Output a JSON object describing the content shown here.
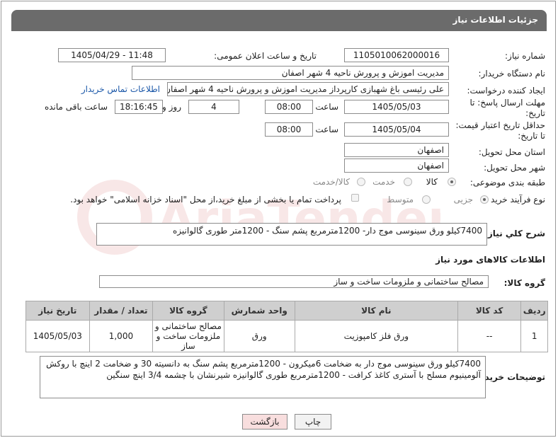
{
  "title": "جزئیات اطلاعات نیاز",
  "fields": {
    "need_number_label": "شماره نیاز:",
    "need_number": "1105010062000016",
    "announce_label": "تاریخ و ساعت اعلان عمومی:",
    "announce_value": "1405/04/29 - 11:48",
    "buyer_org_label": "نام دستگاه خریدار:",
    "buyer_org": "مدیریت اموزش و پرورش ناحیه 4 شهر اصفان",
    "creator_label": "ایجاد کننده درخواست:",
    "creator": "علی رئیسی باغ شهبازی کارپرداز مدیریت اموزش و پرورش ناحیه 4 شهر اصفان",
    "contact_link": "اطلاعات تماس خریدار",
    "deadline_label_1": "مهلت ارسال پاسخ: تا",
    "deadline_label_2": "تاریخ:",
    "deadline_date": "1405/05/03",
    "time_label": "ساعت",
    "deadline_time": "08:00",
    "days_value": "4",
    "days_label": "روز و",
    "remaining_time": "18:16:45",
    "remaining_label": "ساعت باقی مانده",
    "validity_label_1": "حداقل تاریخ اعتبار قیمت:",
    "validity_label_2": "تا تاریخ:",
    "validity_date": "1405/05/04",
    "validity_time": "08:00",
    "province_label": "استان محل تحویل:",
    "province": "اصفهان",
    "city_label": "شهر محل تحویل:",
    "city": "اصفهان",
    "category_label": "طبقه بندی موضوعی:",
    "category_options": [
      "کالا",
      "خدمت",
      "کالا/خدمت"
    ],
    "category_selected": "کالا",
    "process_label": "نوع فرآیند خرید :",
    "process_options": [
      "جزیی",
      "متوسط"
    ],
    "process_selected": "جزیی",
    "payment_note": "پرداخت تمام یا بخشی از مبلغ خرید،از محل \"اسناد خزانه اسلامی\" خواهد بود."
  },
  "summary": {
    "label": "شرح کلي نياز:",
    "value": "7400کیلو ورق سینوسی موج دار- 1200مترمربع پشم سنگ - 1200متر طوری گالوانیزه"
  },
  "goods_section_title": "اطلاعات کالاهای مورد نیاز",
  "goods_group": {
    "label": "گروه کالا:",
    "value": "مصالح ساختمانی و ملزومات ساخت و ساز"
  },
  "goods_table": {
    "headers": [
      "ردیف",
      "کد کالا",
      "نام کالا",
      "واحد شمارش",
      "گروه کالا",
      "تعداد / مقدار",
      "تاریخ نیاز"
    ],
    "rows": [
      {
        "index": "1",
        "code": "--",
        "name": "ورق فلز کامپوزیت",
        "unit": "ورق",
        "group": "مصالح ساختمانی و ملزومات ساخت و ساز",
        "qty": "1,000",
        "date": "1405/05/03"
      }
    ]
  },
  "buyer_notes": {
    "label": "توضیحات خریدار:",
    "value": "7400کیلو ورق سینوسی موج دار به ضخامت 6میکرون - 1200مترمربع پشم سنگ به دانسیته 30 و ضخامت 2 اینچ با روکش آلومینیوم مسلح با آستری کاغذ کرافت - 1200مترمربع طوری گالوانیزه شیرنشان با چشمه 3/4 اینچ سنگین"
  },
  "buttons": {
    "print": "چاپ",
    "back": "بازگشت"
  },
  "watermark": "AriaTender.net"
}
